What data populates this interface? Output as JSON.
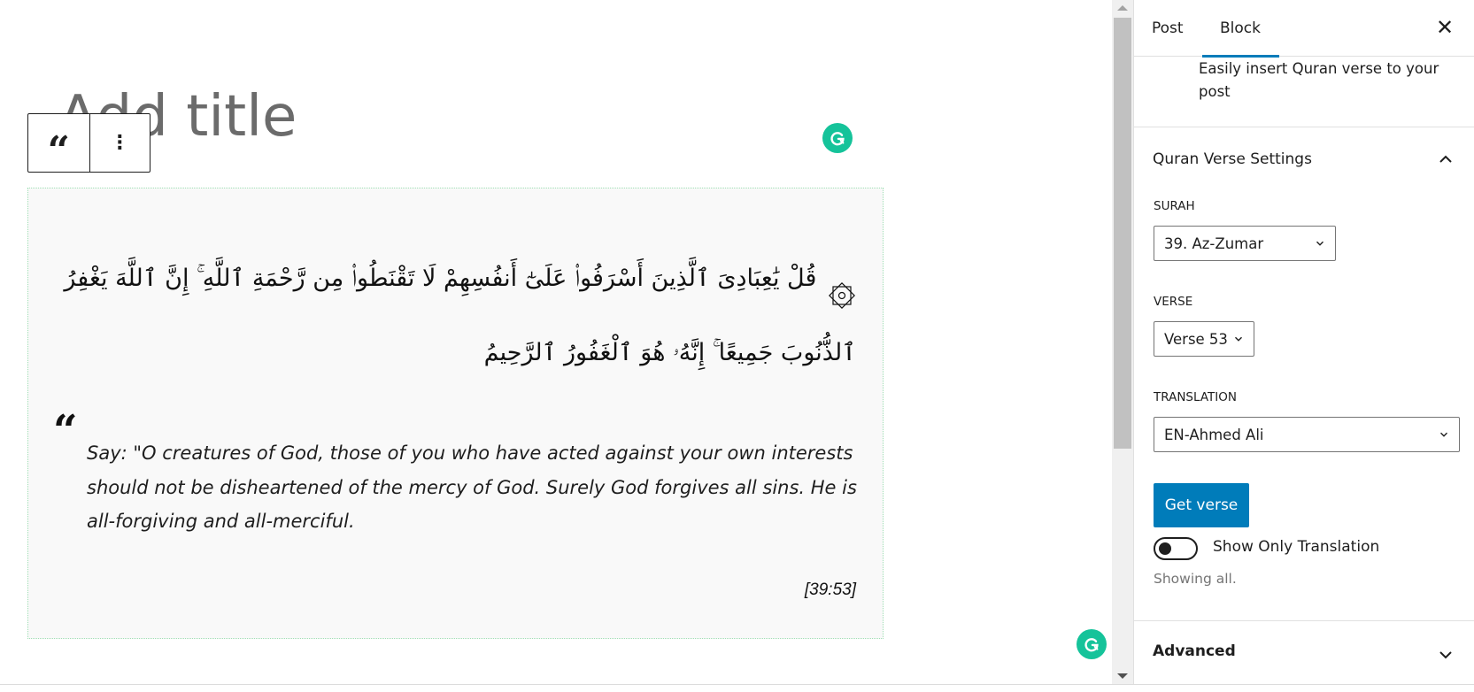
{
  "editor": {
    "title_placeholder": "Add title",
    "toolbar": {
      "block_type_icon": "quote-icon",
      "block_type_glyph": "“",
      "more_options_icon": "more-vertical-icon",
      "more_options_glyph": "⋮"
    },
    "quran_block": {
      "arabic_ornament": "۞",
      "arabic_text": "قُلْ يَٰعِبَادِىَ ٱلَّذِينَ أَسْرَفُوا۟ عَلَىٰٓ أَنفُسِهِمْ لَا تَقْنَطُوا۟ مِن رَّحْمَةِ ٱللَّهِ ۚ إِنَّ ٱللَّهَ يَغْفِرُ ٱلذُّنُوبَ جَمِيعًا ۚ إِنَّهُۥ هُوَ ٱلْغَفُورُ ٱلرَّحِيمُ",
      "quote_mark": "“",
      "translation": "Say: \"O creatures of God, those of you who have acted against your own interests should not be disheartened of the mercy of God. Surely God forgives all sins. He is all-forgiving and all-merciful.",
      "reference": "[39:53]"
    }
  },
  "scrollbar": {
    "up_icon": "arrow-up-icon",
    "down_icon": "arrow-down-icon"
  },
  "sidebar": {
    "tabs": [
      {
        "label": "Post",
        "active": false
      },
      {
        "label": "Block",
        "active": true
      }
    ],
    "close_glyph": "✕",
    "block_description": "Easily insert Quran verse to your post",
    "panel": {
      "title": "Quran Verse Settings",
      "expanded": true,
      "fields": {
        "surah": {
          "label": "Surah",
          "value": "39. Az-Zumar"
        },
        "verse": {
          "label": "Verse",
          "value": "Verse 53"
        },
        "translation": {
          "label": "Translation",
          "value": "EN-Ahmed Ali"
        }
      },
      "get_verse_label": "Get verse",
      "toggle": {
        "label": "Show Only Translation",
        "checked": false
      },
      "help_text": "Showing all."
    },
    "advanced": {
      "title": "Advanced",
      "expanded": false
    }
  },
  "colors": {
    "accent": "#007cba",
    "grammarly": "#15c39a",
    "block_border": "#9fdfb4",
    "block_background": "#f9f9f9"
  }
}
